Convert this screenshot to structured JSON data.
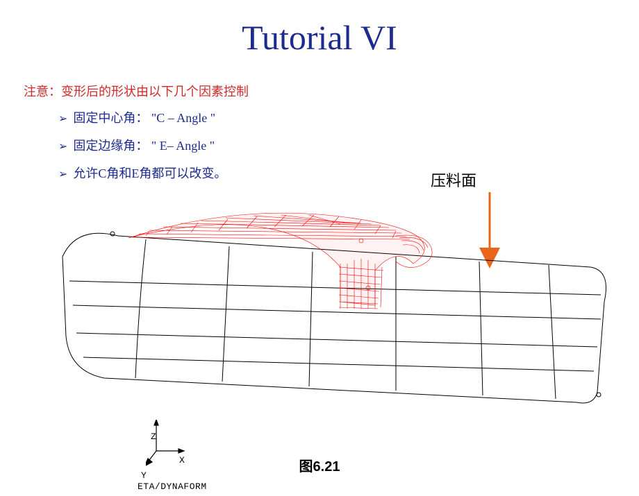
{
  "title": "Tutorial VI",
  "note_intro": "注意：变形后的形状由以下几个因素控制",
  "bullets": [
    "固定中心角： \"C – Angle \"",
    "固定边缘角： \" E– Angle \"",
    "允许C角和E角都可以改变。"
  ],
  "annotation_label": "压料面",
  "caption": "图6.21",
  "software": "ETA/DYNAFORM",
  "axes": {
    "z": "Z",
    "x": "X",
    "y": "Y"
  }
}
